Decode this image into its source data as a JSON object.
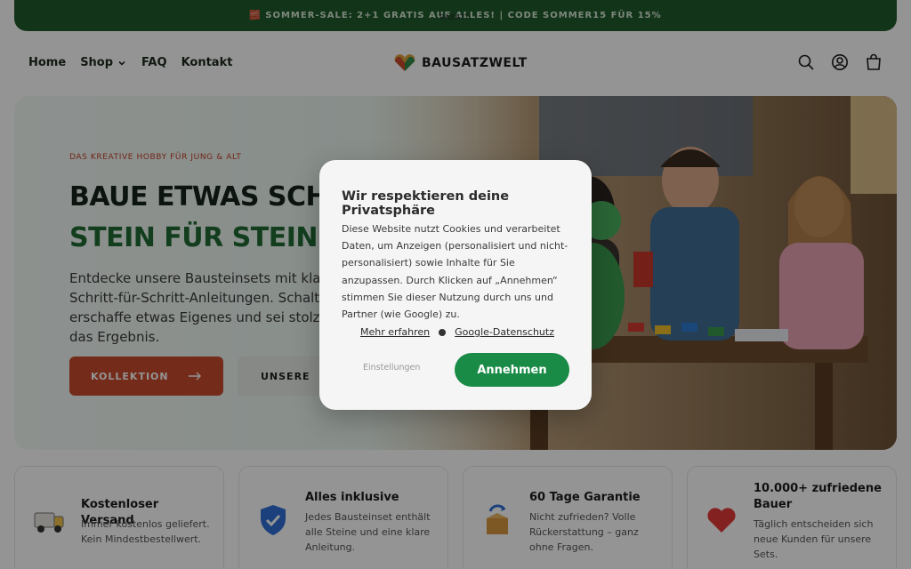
{
  "announcement": {
    "text": "🧱 Sommer-Sale: 2+1 gratis auf alles! | Code SOMMER15 für 15%",
    "sub": "RABATT"
  },
  "nav": {
    "home": "Home",
    "shop": "Shop",
    "faq": "FAQ",
    "contact": "Kontakt"
  },
  "brand": {
    "name": "BAUSATZWELT"
  },
  "hero": {
    "tag": "Das kreative Hobby für Jung & Alt",
    "headline_line1": "BAUE ETWAS SCHÖNES",
    "headline_line2": "STEIN FÜR STEIN.",
    "text": "Entdecke unsere Bausteinsets mit klaren Schritt-für-Schritt-Anleitungen. Schalte ab, erschaffe etwas Eigenes und sei stolz auf das Ergebnis.",
    "primary_label": "KOLLEKTION",
    "secondary_label": "UNSERE"
  },
  "features": [
    {
      "title": "Kostenloser Versand",
      "desc": "Immer kostenlos geliefert. Kein Mindestbestellwert."
    },
    {
      "title": "Alles inklusive",
      "desc": "Jedes Bausteinset enthält alle Steine und eine klare Anleitung."
    },
    {
      "title": "60 Tage Garantie",
      "desc": "Nicht zufrieden? Volle Rückerstattung – ganz ohne Fragen."
    },
    {
      "title": "10.000+ zufriedene Bauer",
      "desc": "Täglich entscheiden sich neue Kunden für unsere Sets."
    }
  ],
  "cookie": {
    "title": "Wir respektieren deine Privatsphäre",
    "text": "Diese Website nutzt Cookies und verarbeitet Daten, um Anzeigen (personalisiert und nicht-personalisiert) sowie Inhalte für Sie anzupassen. Durch Klicken auf „Annehmen“ stimmen Sie dieser Nutzung durch uns und Partner (wie Google) zu.",
    "link_more": "Mehr erfahren",
    "link_google": "Google-Datenschutz",
    "settings_label": "Einstellungen",
    "accept_label": "Annehmen"
  },
  "colors": {
    "green": "#1f5a2c",
    "accent": "#c84a2c",
    "accept": "#1a8b46"
  }
}
